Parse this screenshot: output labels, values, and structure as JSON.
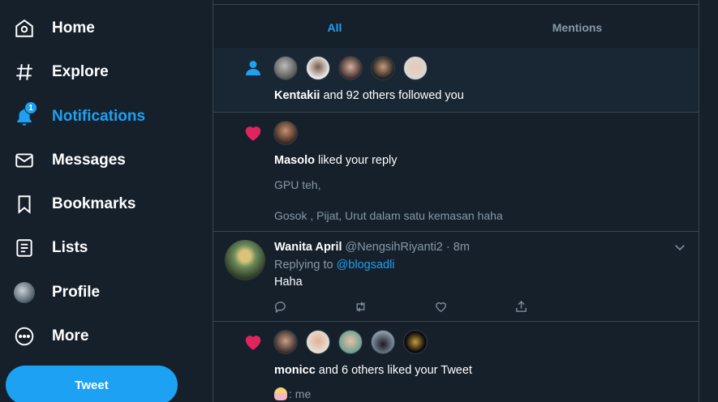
{
  "sidebar": {
    "items": [
      {
        "label": "Home",
        "icon": "home-icon"
      },
      {
        "label": "Explore",
        "icon": "hashtag-icon"
      },
      {
        "label": "Notifications",
        "icon": "bell-icon",
        "badge": "1",
        "active": true
      },
      {
        "label": "Messages",
        "icon": "envelope-icon"
      },
      {
        "label": "Bookmarks",
        "icon": "bookmark-icon"
      },
      {
        "label": "Lists",
        "icon": "list-icon"
      },
      {
        "label": "Profile",
        "icon": "avatar"
      },
      {
        "label": "More",
        "icon": "more-icon"
      }
    ],
    "tweet_button": "Tweet"
  },
  "tabs": [
    {
      "label": "All",
      "active": true
    },
    {
      "label": "Mentions",
      "active": false
    }
  ],
  "notifications": {
    "follow": {
      "actor": "Kentakii",
      "text": " and 92 others followed you"
    },
    "like_reply": {
      "actor": "Masolo",
      "text": " liked your reply",
      "line1": "GPU teh,",
      "line2": "Gosok , Pijat, Urut dalam satu kemasan haha"
    },
    "tweet": {
      "name": "Wanita April",
      "handle": "@NengsihRiyanti2",
      "separator": " · ",
      "time": "8m",
      "replying_prefix": "Replying to ",
      "replying_to": "@blogsadli",
      "body": "Haha"
    },
    "like_tweet": {
      "actor": "monicc",
      "text": " and 6 others liked your Tweet",
      "preview_suffix": ": me"
    }
  },
  "colors": {
    "background": "#15202b",
    "accent": "#1da1f2",
    "like": "#e0245e",
    "muted": "#8899a6",
    "border": "#38444d"
  }
}
